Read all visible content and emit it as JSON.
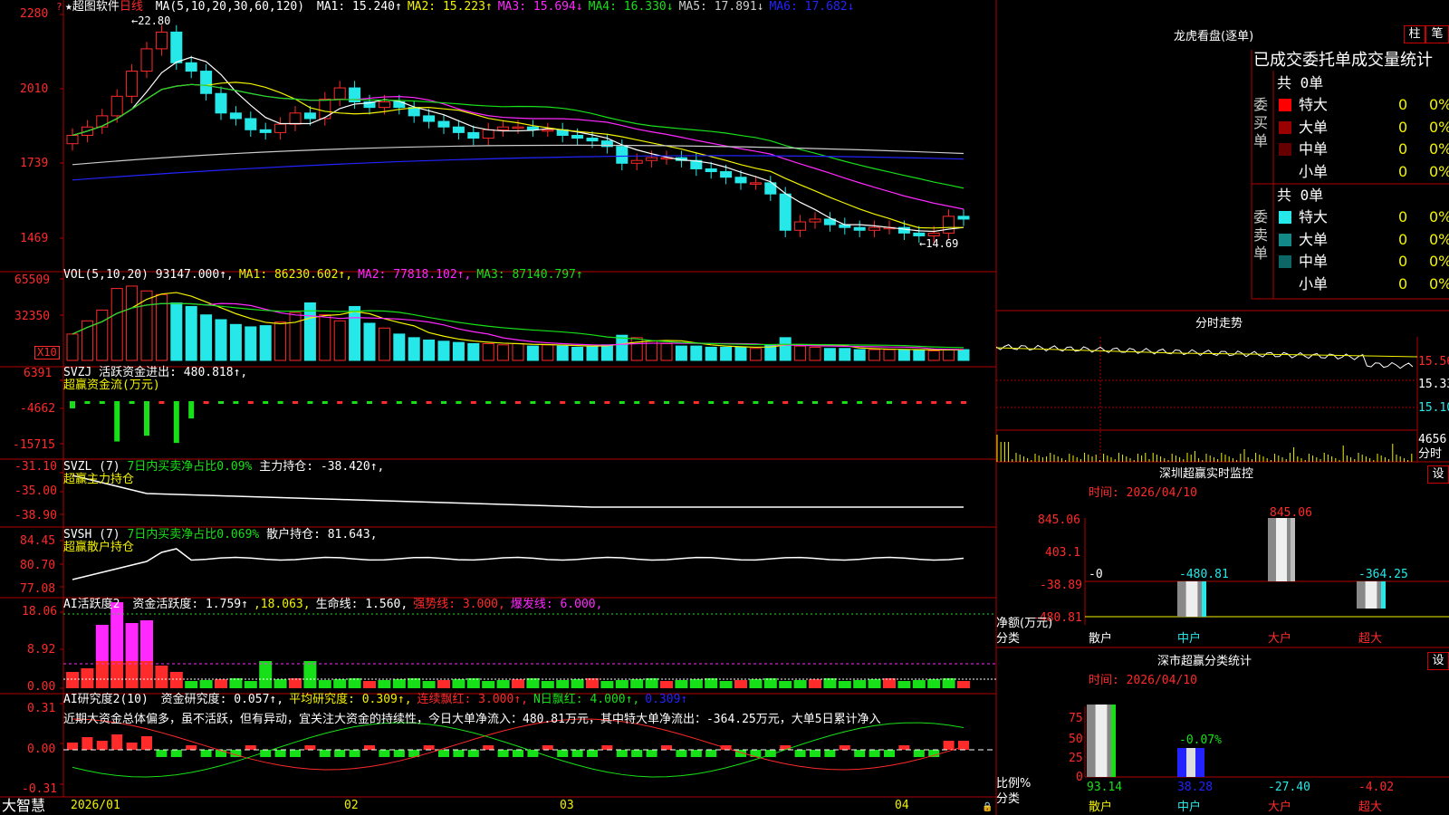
{
  "colors": {
    "up": "#ff2a2a",
    "down": "#26e8e8",
    "green": "#18e018",
    "magenta": "#ff28ff",
    "yellow": "#f2f200",
    "white": "#ffffff",
    "blue": "#2323ff",
    "grid": "#b00000"
  },
  "main": {
    "star": "★",
    "app": "超图软件",
    "period": "日线",
    "ma_title": "MA(5,10,20,30,60,120)",
    "ma": [
      {
        "label": "MA1: 15.240↑",
        "color": "#ffffff"
      },
      {
        "label": "MA2: 15.223↑",
        "color": "#f2f200"
      },
      {
        "label": "MA3: 15.694↓",
        "color": "#ff28ff"
      },
      {
        "label": "MA4: 16.330↓",
        "color": "#18e018"
      },
      {
        "label": "MA5: 17.891↓",
        "color": "#cccccc"
      },
      {
        "label": "MA6: 17.682↓",
        "color": "#2323ff"
      }
    ],
    "y_ticks": [
      "2280",
      "2010",
      "1739",
      "1469"
    ],
    "high_label": "22.80",
    "low_label": "14.69",
    "fill_marker": "?"
  },
  "vol": {
    "title": "VOL(5,10,20)",
    "value": "93147.000↑,",
    "ma": [
      {
        "label": "MA1: 86230.602↑,",
        "color": "#f2f200"
      },
      {
        "label": "MA2: 77818.102↑,",
        "color": "#ff28ff"
      },
      {
        "label": "MA3: 87140.797↑",
        "color": "#18e018"
      }
    ],
    "y_ticks": [
      "65509",
      "32350"
    ],
    "unit": "X10"
  },
  "svzj": {
    "title": "SVZJ  活跃资金进出: 480.818↑,",
    "subtitle": "超赢资金流(万元)",
    "y_ticks": [
      "6391",
      "-4662",
      "-15715"
    ]
  },
  "svzl": {
    "title": "SVZL  (7)",
    "ratio": "7日内买卖净占比0.09%",
    "holding": "主力持仓: -38.420↑,",
    "subtitle": "超赢主力持仓",
    "y_ticks": [
      "-31.10",
      "-35.00",
      "-38.90"
    ]
  },
  "svsh": {
    "title": "SVSH  (7)",
    "ratio": "7日内买卖净占比0.069%",
    "holding": "散户持仓: 81.643,",
    "subtitle": "超赢散户持仓",
    "y_ticks": [
      "84.45",
      "80.70",
      "77.08"
    ]
  },
  "ai1": {
    "title": "AI活跃度2",
    "items": [
      {
        "label": "资金活跃度: 1.759↑",
        "color": "#ffffff"
      },
      {
        "label": ",18.063,",
        "color": "#f2f200"
      },
      {
        "label": "生命线: 1.560,",
        "color": "#ffffff"
      },
      {
        "label": "强势线: 3.000,",
        "color": "#ff2a2a"
      },
      {
        "label": "爆发线: 6.000,",
        "color": "#ff28ff"
      }
    ],
    "y_ticks": [
      "18.06",
      "8.92",
      "0.00"
    ]
  },
  "ai2": {
    "title": "AI研究度2(10)",
    "items": [
      {
        "label": "资金研究度: 0.057↑,",
        "color": "#ffffff"
      },
      {
        "label": "平均研究度: 0.309↑,",
        "color": "#f2f200"
      },
      {
        "label": "连续飘红: 3.000↑,",
        "color": "#ff2a2a"
      },
      {
        "label": "N日飘红: 4.000↑,",
        "color": "#18e018"
      },
      {
        "label": "0.309↑",
        "color": "#2323ff"
      }
    ],
    "comment": "近期大资金总体偏多，虽不活跃，但有异动，宜关注大资金的持续性，今日大单净流入：480.81万元，其中特大单净流出：-364.25万元，大单5日累计净入",
    "y_ticks": [
      "0.31",
      "0.00",
      "-0.31"
    ]
  },
  "xaxis": {
    "logo": "大智慧",
    "labels": [
      "2026/01",
      "02",
      "03",
      "04"
    ]
  },
  "dragon": {
    "title": "龙虎看盘(逐单)",
    "tabs": [
      "柱",
      "笔"
    ],
    "header": "已成交委托单成交量统计",
    "buy_label": "委买单",
    "sell_label": "委卖单",
    "buy_total": "共 0单",
    "sell_total": "共 0单",
    "buy_rows": [
      {
        "name": "特大",
        "count": "0",
        "pct": "0%",
        "color": "#ff0000"
      },
      {
        "name": "大单",
        "count": "0",
        "pct": "0%",
        "color": "#990000"
      },
      {
        "name": "中单",
        "count": "0",
        "pct": "0%",
        "color": "#660000"
      },
      {
        "name": "小单",
        "count": "0",
        "pct": "0%",
        "color": "#000000"
      }
    ],
    "sell_rows": [
      {
        "name": "特大",
        "count": "0",
        "pct": "0%",
        "color": "#26e8e8"
      },
      {
        "name": "大单",
        "count": "0",
        "pct": "0%",
        "color": "#138888"
      },
      {
        "name": "中单",
        "count": "0",
        "pct": "0%",
        "color": "#0d6666"
      },
      {
        "name": "小单",
        "count": "0",
        "pct": "0%",
        "color": "#000000"
      }
    ]
  },
  "intraday": {
    "title": "分时走势",
    "y_ticks": [
      "15.56",
      "15.33",
      "15.10"
    ],
    "vol_tick": "4656",
    "label": "分时"
  },
  "sz_monitor": {
    "title": "深圳超赢实时监控",
    "btn": "设",
    "time": "时间: 2026/04/10",
    "y_ticks": [
      "845.06",
      "403.1",
      "-38.89",
      "-480.81"
    ],
    "zero": "-0",
    "ylabel": "净额(万元)",
    "xlabel": "分类",
    "categories": [
      "散户",
      "中户",
      "大户",
      "超大"
    ],
    "values": [
      "",
      "-480.81",
      "845.06",
      "-364.25"
    ]
  },
  "sz_class": {
    "title": "深市超赢分类统计",
    "btn": "设",
    "time": "时间: 2026/04/10",
    "y_ticks": [
      "75",
      "50",
      "25",
      "0"
    ],
    "ylabel": "比例%",
    "xlabel": "分类",
    "categories": [
      "散户",
      "中户",
      "大户",
      "超大"
    ],
    "values": [
      "93.14",
      "38.28",
      "-27.40",
      "-4.02"
    ],
    "top_label": "-0.07%"
  },
  "chart_data": [
    {
      "type": "candlestick",
      "title": "超图软件 日线",
      "ylim": [
        14.69,
        22.8
      ],
      "y_ticks": [
        "2280",
        "2010",
        "1739",
        "1469"
      ],
      "x_labels": [
        "2026/01",
        "02",
        "03",
        "04"
      ],
      "close": [
        18.6,
        18.9,
        19.3,
        20.0,
        20.9,
        21.7,
        22.3,
        21.2,
        20.9,
        20.1,
        19.4,
        19.2,
        18.8,
        18.7,
        19.0,
        19.4,
        19.2,
        19.9,
        20.3,
        19.8,
        19.6,
        19.8,
        19.6,
        19.3,
        19.1,
        18.9,
        18.7,
        18.5,
        18.8,
        18.9,
        18.9,
        18.8,
        18.8,
        18.6,
        18.5,
        18.4,
        18.2,
        17.6,
        17.7,
        17.8,
        17.8,
        17.7,
        17.4,
        17.3,
        17.1,
        16.9,
        16.9,
        16.5,
        15.2,
        15.5,
        15.6,
        15.4,
        15.3,
        15.2,
        15.3,
        15.3,
        15.1,
        15.0,
        15.1,
        15.7,
        15.6
      ]
    },
    {
      "type": "bar",
      "title": "VOL(5,10,20)",
      "unit": "X10",
      "values": [
        22000,
        33000,
        42000,
        60000,
        62000,
        58000,
        55000,
        48000,
        45000,
        38000,
        34000,
        30000,
        28000,
        29000,
        32000,
        40000,
        48000,
        38000,
        33000,
        45000,
        31000,
        27000,
        22000,
        19000,
        17000,
        16000,
        15000,
        14000,
        14000,
        13000,
        14000,
        12000,
        13000,
        12000,
        11000,
        12000,
        13000,
        21000,
        19000,
        16000,
        14000,
        12000,
        12000,
        11000,
        11000,
        11000,
        10000,
        13000,
        19000,
        12000,
        11000,
        10000,
        10000,
        9000,
        9000,
        9000,
        9000,
        9000,
        8000,
        9000,
        9000
      ]
    },
    {
      "type": "bar",
      "title": "SVZJ 活跃资金进出",
      "values": [
        -2500,
        -300,
        -300,
        -14000,
        -300,
        -12000,
        -300,
        -14500,
        -6000,
        -300,
        -300,
        -300,
        -300,
        -300,
        -300,
        -300,
        -300,
        -300,
        -300,
        -300,
        -300,
        -300,
        -300,
        -300,
        -300,
        -300,
        -300,
        -300,
        -300,
        -300,
        -300,
        -300,
        -300,
        -300,
        -300,
        -300,
        -300,
        -300,
        -300,
        -300,
        -300,
        -300,
        -300,
        -300,
        -300,
        -300,
        -300,
        -300,
        -300,
        -300,
        -300,
        -300,
        -300,
        -300,
        -300,
        -300,
        -300,
        -300,
        -300,
        -300,
        -300
      ]
    },
    {
      "type": "line",
      "title": "AI研究度2(10)",
      "ylim": [
        -0.31,
        0.31
      ]
    }
  ]
}
